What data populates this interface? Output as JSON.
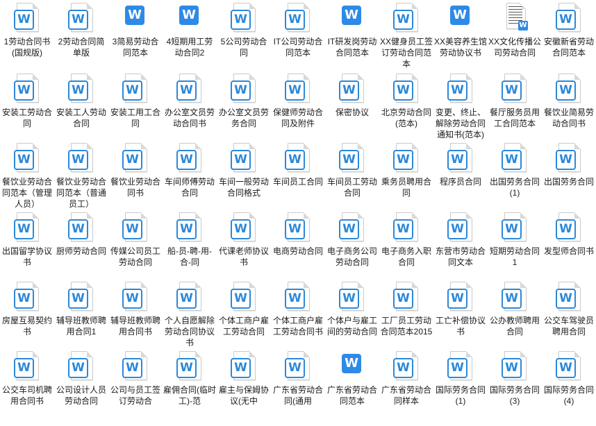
{
  "files": [
    {
      "name": "1劳动合同书(国规版)",
      "style": "outline"
    },
    {
      "name": "2劳动合同简单版",
      "style": "outline"
    },
    {
      "name": "3简易劳动合同范本",
      "style": "solid"
    },
    {
      "name": "4短期用工劳动合同2",
      "style": "solid"
    },
    {
      "name": "5公司劳动合同",
      "style": "outline"
    },
    {
      "name": "IT公司劳动合同范本",
      "style": "outline"
    },
    {
      "name": "IT研发岗劳动合同范本",
      "style": "solid"
    },
    {
      "name": "XX健身员工签订劳动合同范本",
      "style": "outline"
    },
    {
      "name": "XX美容养生馆劳动协议书",
      "style": "solid"
    },
    {
      "name": "XX文化传播公司劳动合同",
      "style": "thumbnail"
    },
    {
      "name": "安徽新省劳动合同范本",
      "style": "outline"
    },
    {
      "name": "安装工劳动合同",
      "style": "outline"
    },
    {
      "name": "安装工人劳动合同",
      "style": "outline"
    },
    {
      "name": "安装工用工合同",
      "style": "outline"
    },
    {
      "name": "办公室文员劳动合同书",
      "style": "outline"
    },
    {
      "name": "办公室文员劳务合同",
      "style": "outline"
    },
    {
      "name": "保健师劳动合同及附件",
      "style": "outline"
    },
    {
      "name": "保密协议",
      "style": "outline"
    },
    {
      "name": "北京劳动合同(范本)",
      "style": "outline"
    },
    {
      "name": "变更、终止、解除劳动合同通知书(范本)",
      "style": "outline"
    },
    {
      "name": "餐厅服务员用工合同范本",
      "style": "outline"
    },
    {
      "name": "餐饮业简易劳动合同书",
      "style": "outline"
    },
    {
      "name": "餐饮业劳动合同范本（管理人员）",
      "style": "outline"
    },
    {
      "name": "餐饮业劳动合同范本（普通员工）",
      "style": "outline"
    },
    {
      "name": "餐饮业劳动合同书",
      "style": "outline"
    },
    {
      "name": "车间师傅劳动合同",
      "style": "outline"
    },
    {
      "name": "车间一般劳动合同格式",
      "style": "outline"
    },
    {
      "name": "车间员工合同",
      "style": "outline"
    },
    {
      "name": "车间员工劳动合同",
      "style": "outline"
    },
    {
      "name": "乘务员聘用合同",
      "style": "outline"
    },
    {
      "name": "程序员合同",
      "style": "outline"
    },
    {
      "name": "出国劳务合同 (1)",
      "style": "outline"
    },
    {
      "name": "出国劳务合同",
      "style": "outline"
    },
    {
      "name": "出国留学协议书",
      "style": "outline"
    },
    {
      "name": "厨师劳动合同",
      "style": "outline"
    },
    {
      "name": "传媒公司员工劳动合同",
      "style": "outline"
    },
    {
      "name": "船-员-聘-用-合-同",
      "style": "outline"
    },
    {
      "name": "代课老师协议书",
      "style": "outline"
    },
    {
      "name": "电商劳动合同",
      "style": "outline"
    },
    {
      "name": "电子商务公司劳动合同",
      "style": "outline"
    },
    {
      "name": "电子商务入职合同",
      "style": "outline"
    },
    {
      "name": "东营市劳动合同文本",
      "style": "outline"
    },
    {
      "name": "短期劳动合同1",
      "style": "outline"
    },
    {
      "name": "发型师合同书",
      "style": "outline"
    },
    {
      "name": "房屋互易契约书",
      "style": "outline"
    },
    {
      "name": "辅导班教师聘用合同1",
      "style": "outline"
    },
    {
      "name": "辅导班教师聘用合同书",
      "style": "outline"
    },
    {
      "name": "个人自愿解除劳动合同协议书",
      "style": "outline"
    },
    {
      "name": "个体工商户雇工劳动合同",
      "style": "outline"
    },
    {
      "name": "个体工商户雇工劳动合同书",
      "style": "outline"
    },
    {
      "name": "个体户与雇工间的劳动合同",
      "style": "outline"
    },
    {
      "name": "工厂员工劳动合同范本2015",
      "style": "outline"
    },
    {
      "name": "工亡补偿协议书",
      "style": "outline"
    },
    {
      "name": "公办教师聘用合同",
      "style": "outline"
    },
    {
      "name": "公交车驾驶员聘用合同",
      "style": "outline"
    },
    {
      "name": "公交车司机聘用合同书",
      "style": "outline"
    },
    {
      "name": "公司设计人员劳动合同",
      "style": "outline"
    },
    {
      "name": "公司与员工签订劳动合",
      "style": "outline"
    },
    {
      "name": "雇佣合同(临时工)-范",
      "style": "outline"
    },
    {
      "name": "雇主与保姆协议(无中",
      "style": "outline"
    },
    {
      "name": "广东省劳动合同(通用",
      "style": "outline"
    },
    {
      "name": "广东省劳动合同范本",
      "style": "solid"
    },
    {
      "name": "广东省劳动合同样本",
      "style": "outline"
    },
    {
      "name": "国际劳务合同 (1)",
      "style": "outline"
    },
    {
      "name": "国际劳务合同 (3)",
      "style": "outline"
    },
    {
      "name": "国际劳务合同 (4)",
      "style": "outline"
    }
  ],
  "icons": {
    "word_glyph": "W",
    "word_color": "#2b88d9"
  }
}
